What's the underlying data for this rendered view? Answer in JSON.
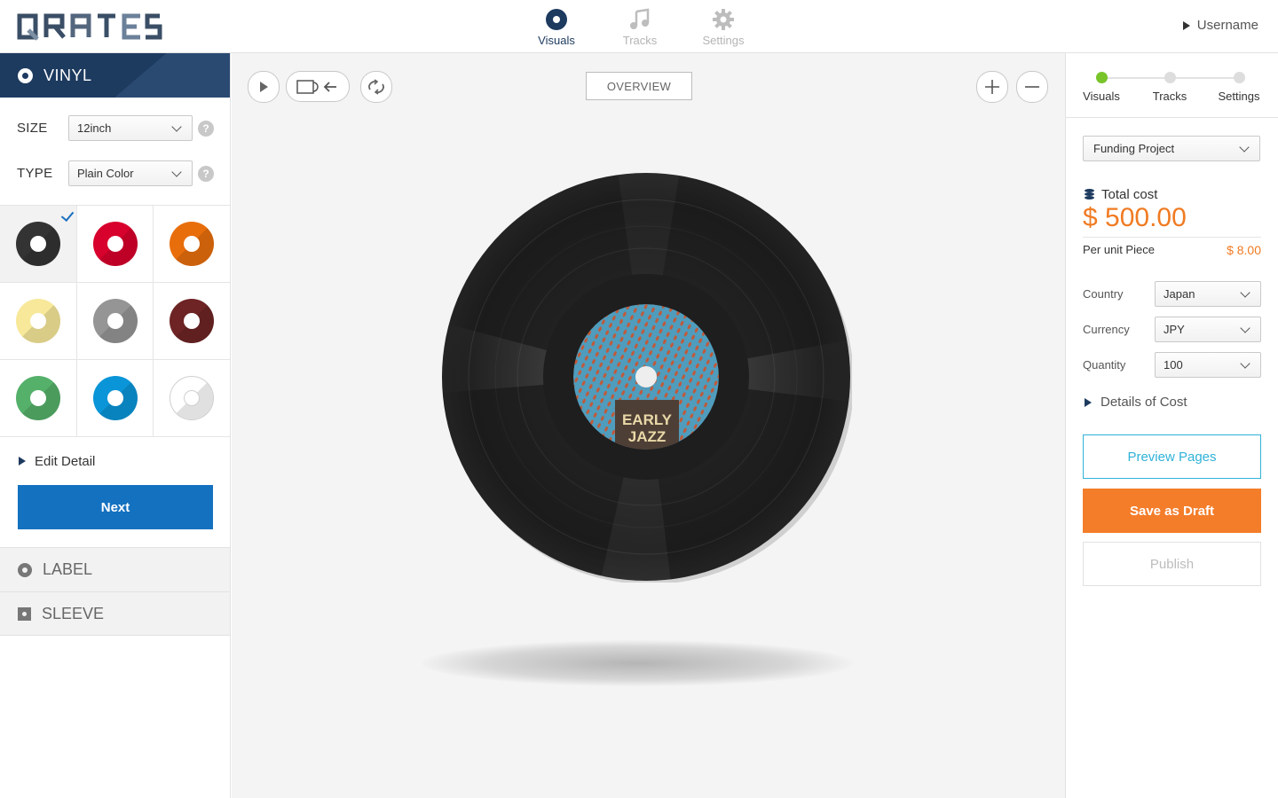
{
  "app": {
    "logo_text": "QRATES"
  },
  "top_nav": [
    {
      "label": "Visuals",
      "icon": "record-icon",
      "active": true
    },
    {
      "label": "Tracks",
      "icon": "music-note-icon",
      "active": false
    },
    {
      "label": "Settings",
      "icon": "gear-icon",
      "active": false
    }
  ],
  "user": {
    "name": "Username"
  },
  "left_panel": {
    "vinyl_section": {
      "title": "VINYL",
      "size": {
        "label": "SIZE",
        "value": "12inch"
      },
      "type": {
        "label": "TYPE",
        "value": "Plain Color"
      },
      "help_glyph": "?",
      "colors": [
        {
          "name": "black",
          "hex": "#333333",
          "selected": true
        },
        {
          "name": "red",
          "hex": "#d8002c",
          "selected": false
        },
        {
          "name": "orange",
          "hex": "#e86e0c",
          "selected": false
        },
        {
          "name": "yellow",
          "hex": "#f7e89a",
          "selected": false
        },
        {
          "name": "gray",
          "hex": "#959595",
          "selected": false
        },
        {
          "name": "maroon",
          "hex": "#6e2424",
          "selected": false
        },
        {
          "name": "green",
          "hex": "#55b06a",
          "selected": false
        },
        {
          "name": "blue",
          "hex": "#0a95d8",
          "selected": false
        },
        {
          "name": "clear",
          "hex": "#ffffff",
          "selected": false
        }
      ],
      "edit_detail": "Edit Detail",
      "next_button": "Next"
    },
    "label_section": {
      "title": "LABEL"
    },
    "sleeve_section": {
      "title": "SLEEVE"
    }
  },
  "center": {
    "overview_button": "OVERVIEW",
    "record_label": {
      "line1": "EARLY",
      "line2": "JAZZ"
    }
  },
  "right_panel": {
    "steps": [
      {
        "label": "Visuals",
        "active": true
      },
      {
        "label": "Tracks",
        "active": false
      },
      {
        "label": "Settings",
        "active": false
      }
    ],
    "project_select": "Funding Project",
    "total_cost_label": "Total cost",
    "total_cost_value": "$ 500.00",
    "unit_label": "Per unit Piece",
    "unit_price": "$ 8.00",
    "country": {
      "label": "Country",
      "value": "Japan"
    },
    "currency": {
      "label": "Currency",
      "value": "JPY"
    },
    "quantity": {
      "label": "Quantity",
      "value": "100"
    },
    "details_of_cost": "Details of Cost",
    "preview_button": "Preview Pages",
    "draft_button": "Save as Draft",
    "publish_button": "Publish"
  },
  "colors": {
    "navy": "#1d3a5f",
    "primary_blue": "#1471c0",
    "orange": "#f07b23",
    "cyan": "#30b2d8",
    "green": "#78c42a"
  }
}
